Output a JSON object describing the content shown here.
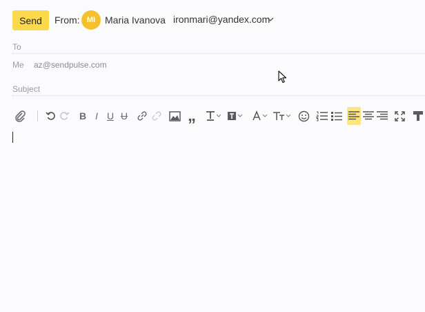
{
  "header": {
    "send_label": "Send",
    "from_label": "From:",
    "avatar_initials": "MI",
    "sender_name": "Maria Ivanova",
    "sender_email": "ironmari@yandex.com"
  },
  "fields": {
    "to_label": "To",
    "me_label": "Me",
    "me_value": "az@sendpulse.com",
    "subject_label": "Subject"
  },
  "toolbar": {
    "quote_glyph": "„"
  },
  "colors": {
    "accent": "#fcd94a",
    "avatar": "#f5c02c",
    "active_tool": "#fbe67e"
  }
}
